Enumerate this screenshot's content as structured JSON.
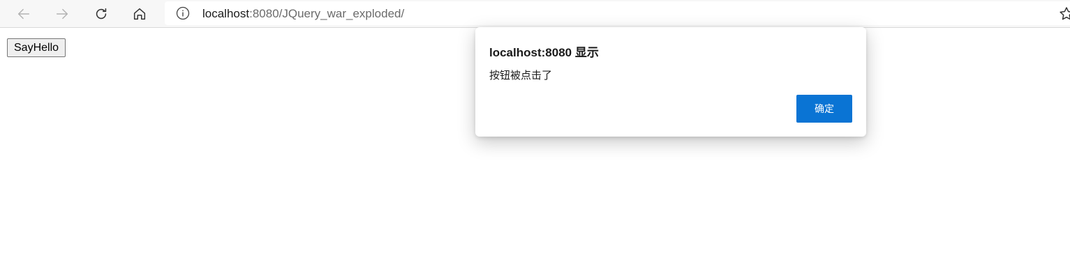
{
  "browser": {
    "back_icon": "arrow-left-icon",
    "forward_icon": "arrow-right-icon",
    "reload_icon": "refresh-icon",
    "home_icon": "home-icon",
    "info_icon": "info-icon",
    "favorite_icon": "star-add-icon",
    "url_host": "localhost",
    "url_rest": ":8080/JQuery_war_exploded/"
  },
  "page": {
    "button_label": "SayHello"
  },
  "dialog": {
    "title": "localhost:8080 显示",
    "message": "按钮被点击了",
    "ok_label": "确定",
    "ok_color": "#0a74d4"
  },
  "colors": {
    "toolbar_bg": "#f7f7f7",
    "icon_disabled": "#b3b3b3",
    "icon_active": "#333333"
  }
}
